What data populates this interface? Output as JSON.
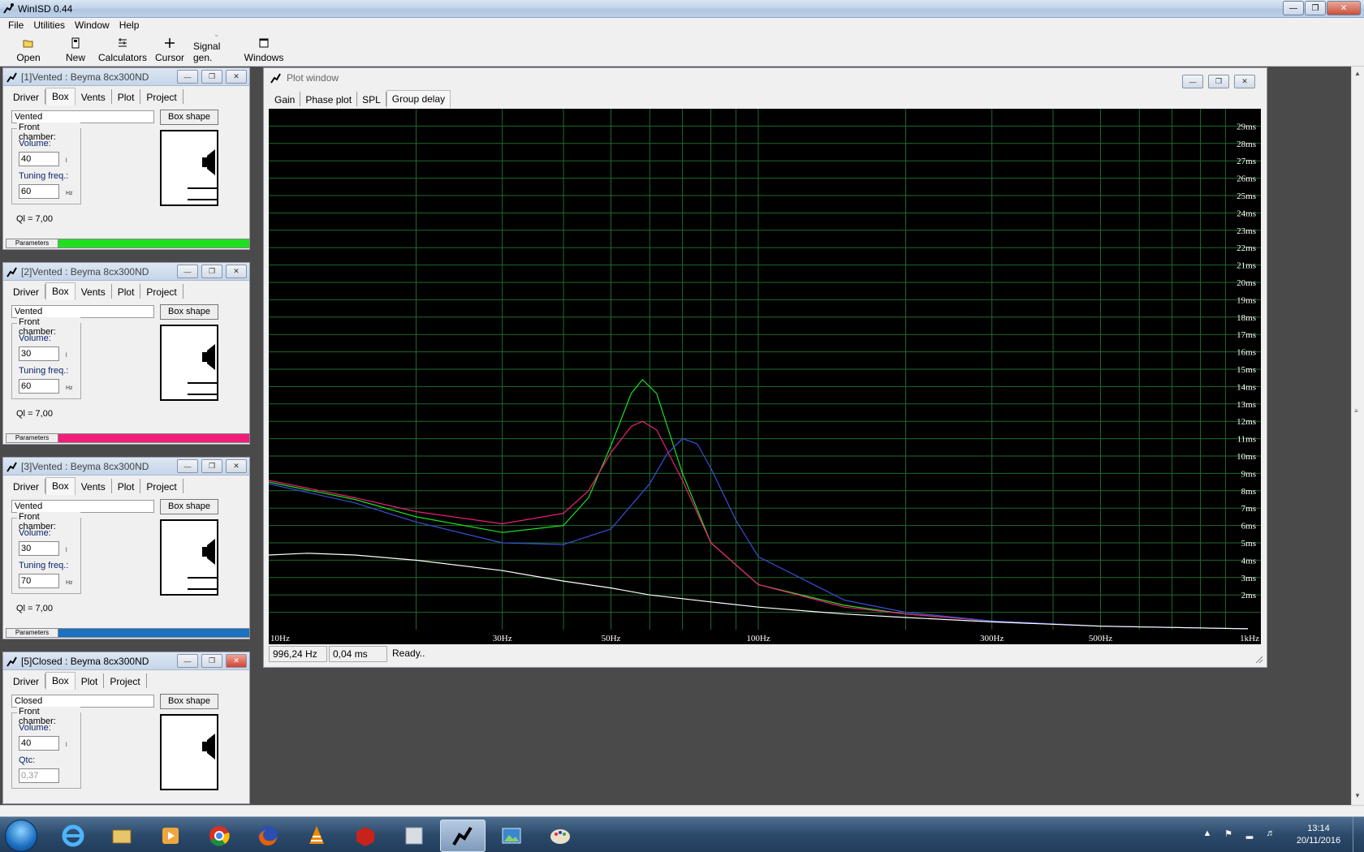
{
  "app": {
    "title": "WinISD 0.44"
  },
  "menu": [
    "File",
    "Utilities",
    "Window",
    "Help"
  ],
  "toolbar": [
    {
      "label": "Open",
      "icon": "open-folder-icon"
    },
    {
      "label": "New",
      "icon": "new-document-icon"
    },
    {
      "label": "Calculators",
      "icon": "calculator-icon"
    },
    {
      "label": "Cursor",
      "icon": "crosshair-cursor-icon"
    },
    {
      "label": "Signal gen.",
      "icon": "signal-generator-icon"
    },
    {
      "label": "Windows",
      "icon": "windows-icon"
    }
  ],
  "projects": [
    {
      "title": "[1]Vented : Beyma 8cx300ND",
      "tabs": [
        "Driver",
        "Box",
        "Vents",
        "Plot",
        "Project"
      ],
      "active_tab": "Box",
      "box_type": "Vented",
      "box_shape_label": "Box shape",
      "front_chamber": "Front chamber:",
      "field1_label": "Volume:",
      "field1_value": "40",
      "field1_unit": "l",
      "field2_label": "Tuning freq.:",
      "field2_value": "60",
      "field2_unit": "Hz",
      "ql": "Ql = 7,00",
      "params_label": "Parameters",
      "color": "#1fe01f"
    },
    {
      "title": "[2]Vented : Beyma 8cx300ND",
      "tabs": [
        "Driver",
        "Box",
        "Vents",
        "Plot",
        "Project"
      ],
      "active_tab": "Box",
      "box_type": "Vented",
      "box_shape_label": "Box shape",
      "front_chamber": "Front chamber:",
      "field1_label": "Volume:",
      "field1_value": "30",
      "field1_unit": "l",
      "field2_label": "Tuning freq.:",
      "field2_value": "60",
      "field2_unit": "Hz",
      "ql": "Ql = 7,00",
      "params_label": "Parameters",
      "color": "#f01e7a"
    },
    {
      "title": "[3]Vented : Beyma 8cx300ND",
      "tabs": [
        "Driver",
        "Box",
        "Vents",
        "Plot",
        "Project"
      ],
      "active_tab": "Box",
      "box_type": "Vented",
      "box_shape_label": "Box shape",
      "front_chamber": "Front chamber:",
      "field1_label": "Volume:",
      "field1_value": "30",
      "field1_unit": "l",
      "field2_label": "Tuning freq.:",
      "field2_value": "70",
      "field2_unit": "Hz",
      "ql": "Ql = 7,00",
      "params_label": "Parameters",
      "color": "#1a72c0"
    },
    {
      "title": "[5]Closed : Beyma 8cx300ND",
      "tabs": [
        "Driver",
        "Box",
        "Plot",
        "Project"
      ],
      "active_tab": "Box",
      "box_type": "Closed",
      "box_shape_label": "Box shape",
      "front_chamber": "Front chamber:",
      "field1_label": "Volume:",
      "field1_value": "40",
      "field1_unit": "l",
      "field2_label": "Qtc:",
      "field2_value": "0,37",
      "field2_unit": "",
      "ql": "",
      "params_label": "",
      "color": ""
    }
  ],
  "plot_window": {
    "title": "Plot window",
    "tabs": [
      "Gain",
      "Phase plot",
      "SPL",
      "Group delay"
    ],
    "active_tab": "Group delay",
    "status": {
      "freq": "996,24 Hz",
      "value": "0,04 ms",
      "message": "Ready.."
    }
  },
  "chart_data": {
    "type": "line",
    "x_scale": "log",
    "xlim": [
      10,
      1000
    ],
    "ylim": [
      0,
      30
    ],
    "x_tick_labels": [
      {
        "v": 10,
        "t": "10Hz"
      },
      {
        "v": 30,
        "t": "30Hz"
      },
      {
        "v": 50,
        "t": "50Hz"
      },
      {
        "v": 100,
        "t": "100Hz"
      },
      {
        "v": 300,
        "t": "300Hz"
      },
      {
        "v": 500,
        "t": "500Hz"
      },
      {
        "v": 1000,
        "t": "1kHz"
      }
    ],
    "y_tick_labels": [
      "2ms",
      "3ms",
      "4ms",
      "5ms",
      "6ms",
      "7ms",
      "8ms",
      "9ms",
      "10ms",
      "11ms",
      "12ms",
      "13ms",
      "14ms",
      "15ms",
      "16ms",
      "17ms",
      "18ms",
      "19ms",
      "20ms",
      "21ms",
      "22ms",
      "23ms",
      "24ms",
      "25ms",
      "26ms",
      "27ms",
      "28ms",
      "29ms"
    ],
    "grid": true,
    "background": "#000000",
    "grid_color": "#1f6b2a",
    "series": [
      {
        "color": "#1fe01f",
        "points": [
          [
            10,
            8.5
          ],
          [
            15,
            7.5
          ],
          [
            20,
            6.5
          ],
          [
            30,
            5.6
          ],
          [
            40,
            6.0
          ],
          [
            45,
            7.6
          ],
          [
            50,
            10.6
          ],
          [
            55,
            13.6
          ],
          [
            58,
            14.4
          ],
          [
            62,
            13.6
          ],
          [
            70,
            9.0
          ],
          [
            80,
            5.0
          ],
          [
            100,
            2.6
          ],
          [
            150,
            1.4
          ],
          [
            200,
            0.9
          ],
          [
            300,
            0.5
          ],
          [
            500,
            0.2
          ],
          [
            1000,
            0.05
          ]
        ]
      },
      {
        "color": "#f01e7a",
        "points": [
          [
            10,
            8.6
          ],
          [
            15,
            7.6
          ],
          [
            20,
            6.8
          ],
          [
            30,
            6.1
          ],
          [
            40,
            6.7
          ],
          [
            45,
            8.0
          ],
          [
            50,
            10.2
          ],
          [
            55,
            11.7
          ],
          [
            58,
            12.0
          ],
          [
            62,
            11.5
          ],
          [
            70,
            8.6
          ],
          [
            80,
            5.0
          ],
          [
            100,
            2.6
          ],
          [
            150,
            1.3
          ],
          [
            200,
            0.9
          ],
          [
            300,
            0.5
          ],
          [
            500,
            0.2
          ],
          [
            1000,
            0.05
          ]
        ]
      },
      {
        "color": "#3a4fd8",
        "points": [
          [
            10,
            8.4
          ],
          [
            15,
            7.3
          ],
          [
            20,
            6.2
          ],
          [
            30,
            5.0
          ],
          [
            40,
            4.9
          ],
          [
            50,
            5.8
          ],
          [
            60,
            8.4
          ],
          [
            65,
            10.1
          ],
          [
            70,
            11.0
          ],
          [
            75,
            10.7
          ],
          [
            80,
            9.3
          ],
          [
            90,
            6.3
          ],
          [
            100,
            4.2
          ],
          [
            150,
            1.7
          ],
          [
            200,
            1.0
          ],
          [
            300,
            0.5
          ],
          [
            500,
            0.2
          ],
          [
            1000,
            0.05
          ]
        ]
      },
      {
        "color": "#ffffff",
        "points": [
          [
            10,
            4.3
          ],
          [
            12,
            4.4
          ],
          [
            15,
            4.3
          ],
          [
            20,
            4.0
          ],
          [
            30,
            3.4
          ],
          [
            40,
            2.8
          ],
          [
            50,
            2.4
          ],
          [
            60,
            2.0
          ],
          [
            80,
            1.6
          ],
          [
            100,
            1.3
          ],
          [
            150,
            0.9
          ],
          [
            200,
            0.7
          ],
          [
            300,
            0.45
          ],
          [
            500,
            0.2
          ],
          [
            1000,
            0.05
          ]
        ]
      }
    ]
  },
  "taskbar": {
    "apps": [
      "start-orb",
      "ie-icon",
      "explorer-icon",
      "media-player-icon",
      "chrome-icon",
      "firefox-icon",
      "vlc-icon",
      "sketchup-icon",
      "daemon-tools-icon",
      "winisd-icon",
      "photo-viewer-icon",
      "paint-icon"
    ],
    "active_app": "winisd-icon",
    "clock_time": "13:14",
    "clock_date": "20/11/2016"
  }
}
